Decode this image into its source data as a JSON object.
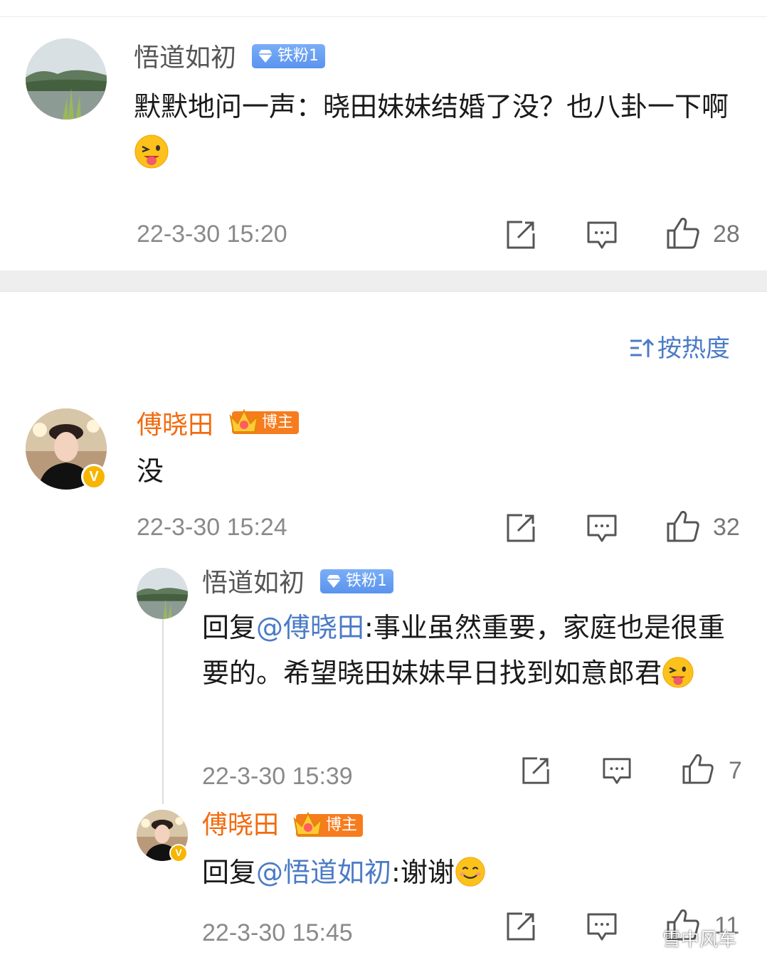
{
  "comment1": {
    "username": "悟道如初",
    "badge": "铁粉1",
    "text": "默默地问一声：晓田妹妹结婚了没？也八卦一下啊",
    "emoji": "tongue-out-emoji",
    "timestamp": "22-3-30 15:20",
    "likes": "28"
  },
  "sort": {
    "label": "按热度",
    "icon": "sort-icon"
  },
  "comment2": {
    "username": "傅晓田",
    "badge": "博主",
    "text": "没",
    "timestamp": "22-3-30 15:24",
    "likes": "32",
    "replies": [
      {
        "username": "悟道如初",
        "badge": "铁粉1",
        "reply_prefix": "回复",
        "mention": "@傅晓田",
        "text": ":事业虽然重要，家庭也是很重要的。希望晓田妹妹早日找到如意郎君",
        "emoji": "tongue-out-emoji",
        "timestamp": "22-3-30 15:39",
        "likes": "7"
      },
      {
        "username": "傅晓田",
        "badge": "博主",
        "reply_prefix": "回复",
        "mention": "@悟道如初",
        "text": ":谢谢",
        "emoji": "smile-emoji",
        "timestamp": "22-3-30 15:45",
        "likes": "11"
      }
    ]
  },
  "watermark": "雪中风车",
  "colors": {
    "username_host": "#f26b0f",
    "mention": "#4b7bc6",
    "fan_badge": "#6aa1f3",
    "host_badge": "#f67c1e",
    "verified": "#f7b500"
  }
}
